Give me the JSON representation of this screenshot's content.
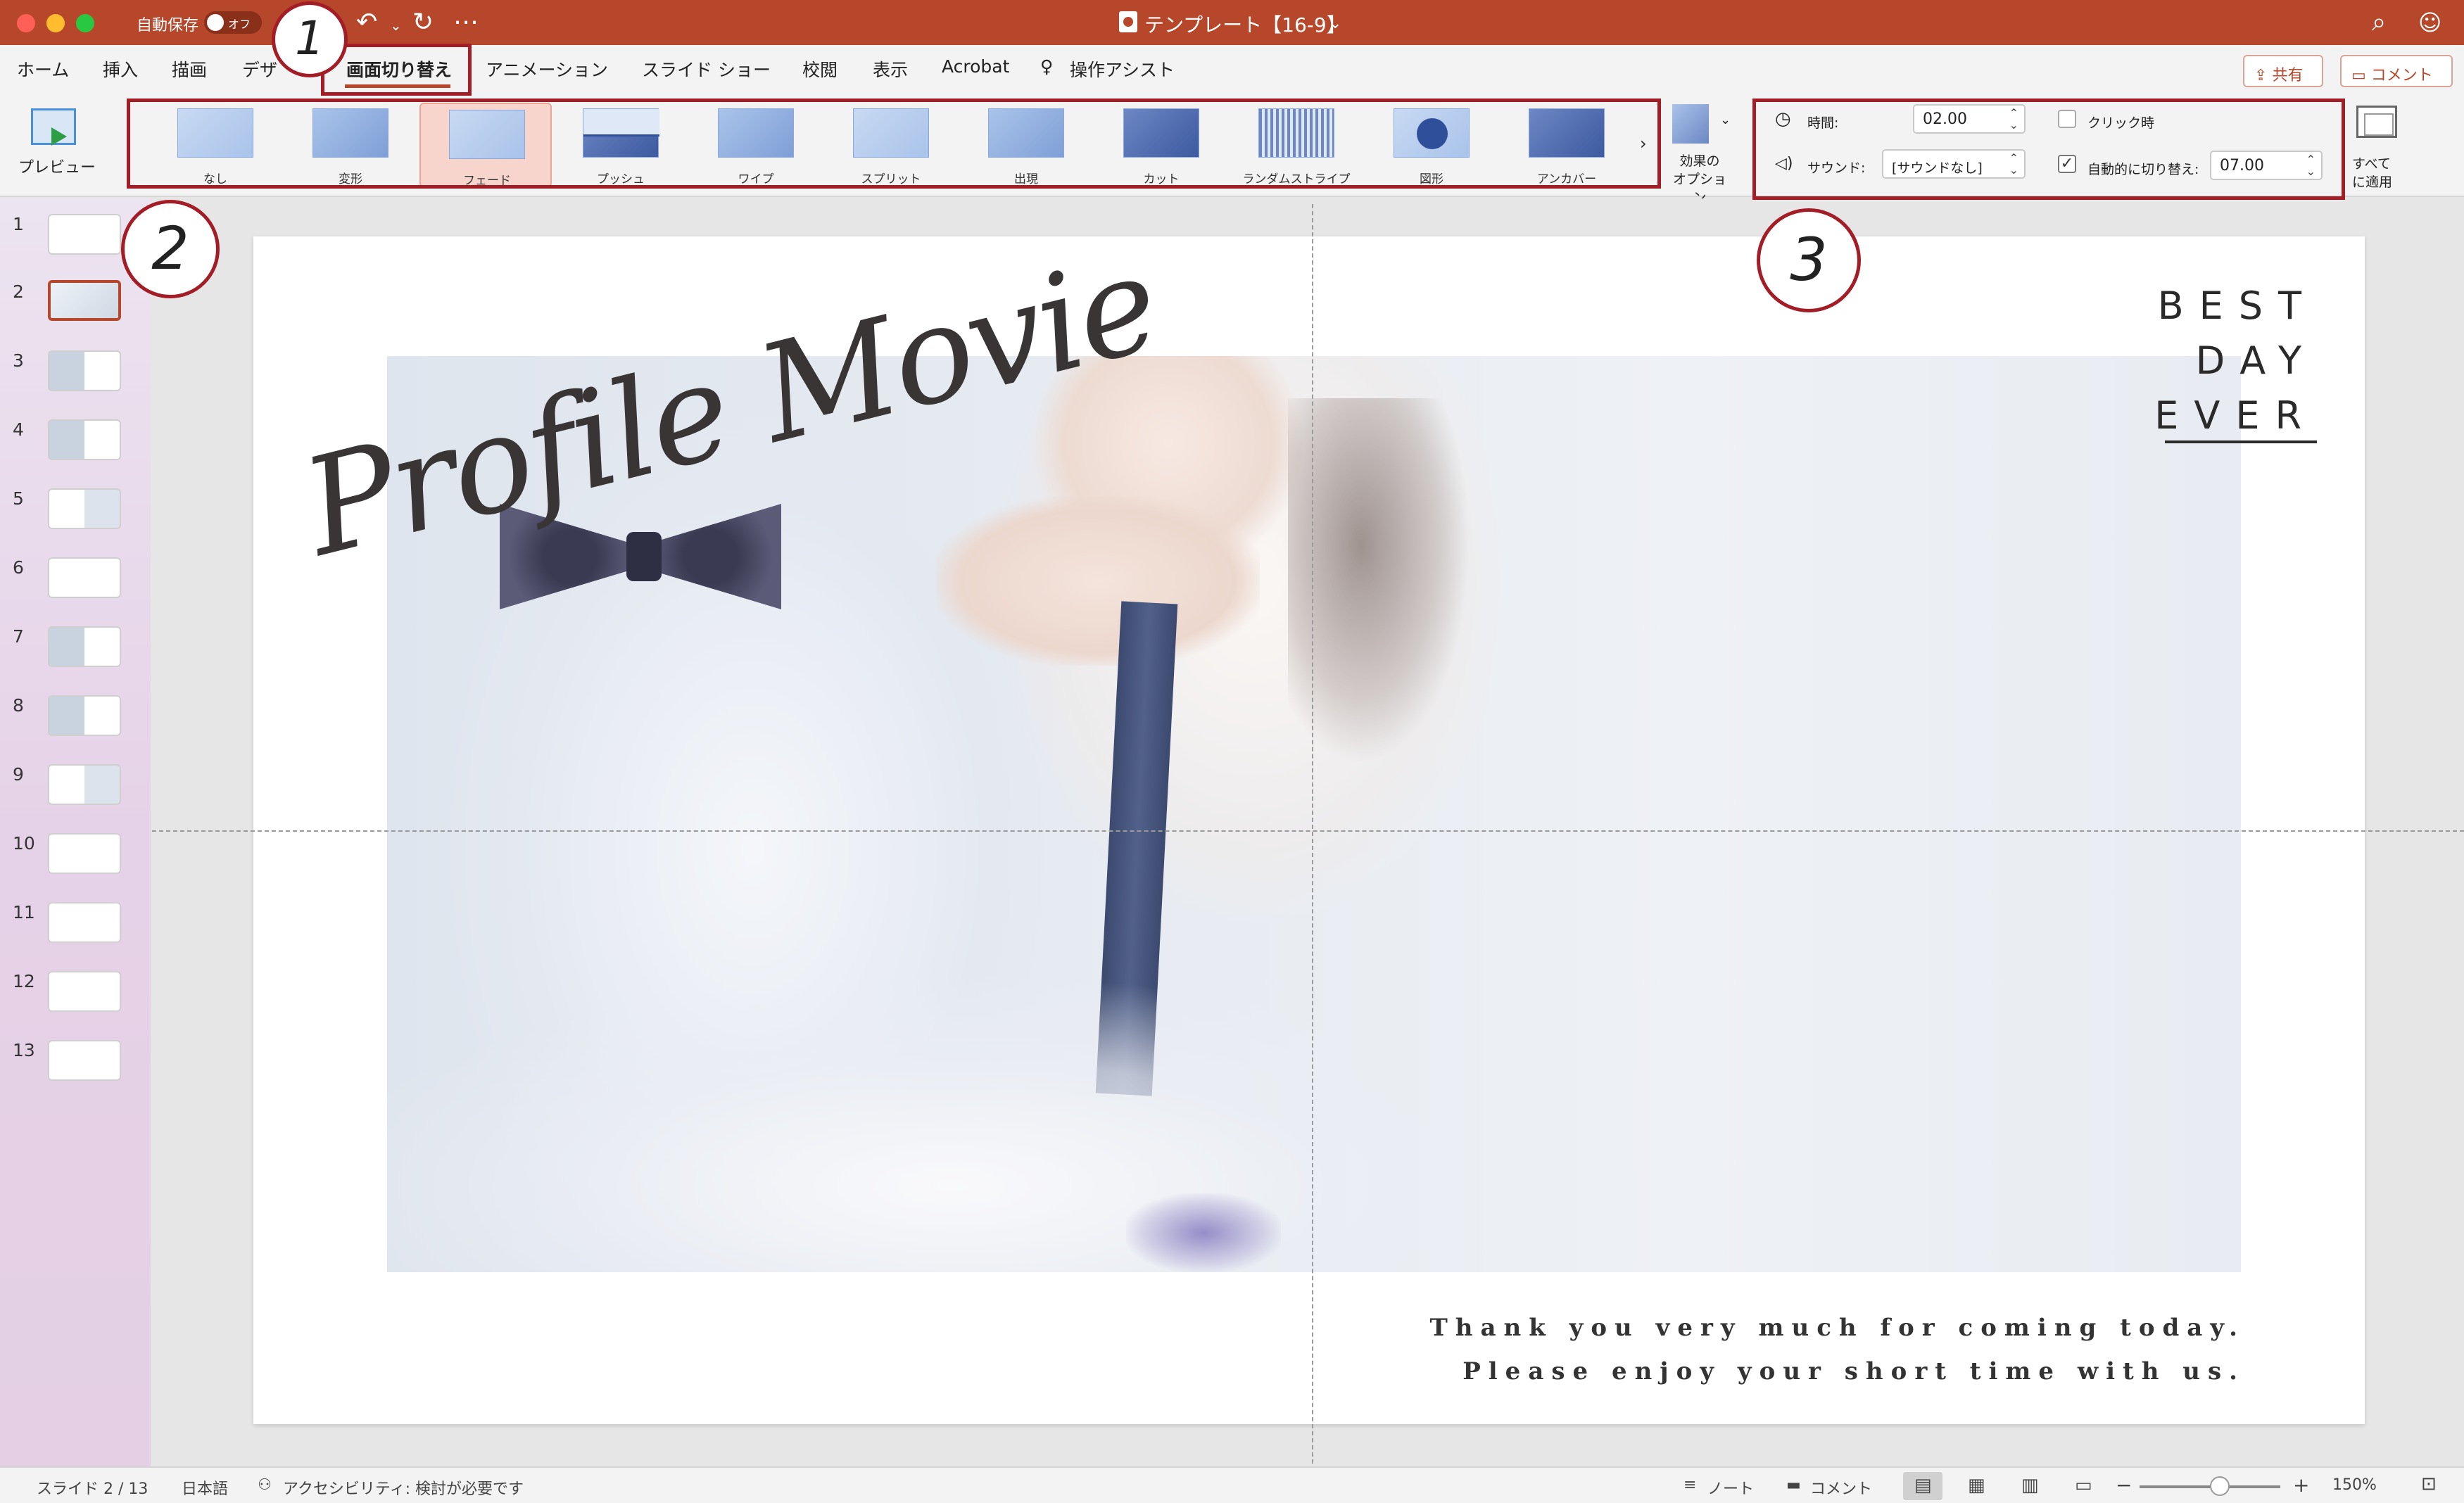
{
  "titlebar": {
    "autosave_label": "自動保存",
    "autosave_state": "オフ",
    "document_title": "テンプレート【16-9】",
    "title_chevron": "⌄",
    "undo_icon": "↶",
    "undo_chevron": "⌄",
    "redo_icon": "↻",
    "more_icon": "⋯",
    "search_icon": "⌕",
    "account_icon": "☺"
  },
  "menu": {
    "tabs": [
      "ホーム",
      "挿入",
      "描画",
      "デザ",
      "画面切り替え",
      "アニメーション",
      "スライド ショー",
      "校閲",
      "表示",
      "Acrobat",
      "操作アシスト"
    ],
    "lightbulb_icon": "♀",
    "share_label": "共有",
    "share_icon": "⇪",
    "comment_label": "コメント",
    "comment_icon": "▭"
  },
  "ribbon": {
    "preview_label": "プレビュー",
    "transitions": [
      "なし",
      "変形",
      "フェード",
      "プッシュ",
      "ワイプ",
      "スプリット",
      "出現",
      "カット",
      "ランダムストライプ",
      "図形",
      "アンカバー"
    ],
    "gallery_more": "›",
    "effect_options_line1": "効果の",
    "effect_options_line2": "オプション",
    "effect_chev": "⌄",
    "duration_label": "時間:",
    "duration_value": "02.00",
    "sound_label": "サウンド:",
    "sound_value": "[サウンドなし]",
    "spin_arrows": "⌃\n⌄",
    "on_click_label": "クリック時",
    "auto_advance_label": "自動的に切り替え:",
    "auto_advance_value": "07.00",
    "checkmark": "✓",
    "clock_icon": "◷",
    "speaker_icon": "◁)",
    "apply_all_line1": "すべて",
    "apply_all_line2": "に適用"
  },
  "annotations": [
    "1",
    "2",
    "3"
  ],
  "slides": {
    "numbers": [
      "1",
      "2",
      "3",
      "4",
      "5",
      "6",
      "7",
      "8",
      "9",
      "10",
      "11",
      "12",
      "13"
    ],
    "active": 2
  },
  "slide_content": {
    "script_title": "Profile Movie",
    "best_line1": "BEST",
    "best_line2": "DAY",
    "best_line3": "EVER",
    "thanks_line1": "Thank you very much for coming today.",
    "thanks_line2": "Please enjoy your short time with us."
  },
  "statusbar": {
    "slide_indicator": "スライド 2 / 13",
    "language": "日本語",
    "accessibility": "アクセシビリティ: 検討が必要です",
    "accessibility_icon": "⚇",
    "notes_label": "ノート",
    "notes_icon": "≡",
    "comments_label": "コメント",
    "comments_icon": "▬",
    "view_normal_icon": "▤",
    "view_sorter_icon": "▦",
    "view_reading_icon": "▥",
    "view_slideshow_icon": "▭",
    "zoom_minus": "−",
    "zoom_plus": "+",
    "zoom_level": "150%",
    "fit_icon": "⊡"
  },
  "colors": {
    "accent": "#b7472a",
    "annotation": "#a31d27"
  }
}
